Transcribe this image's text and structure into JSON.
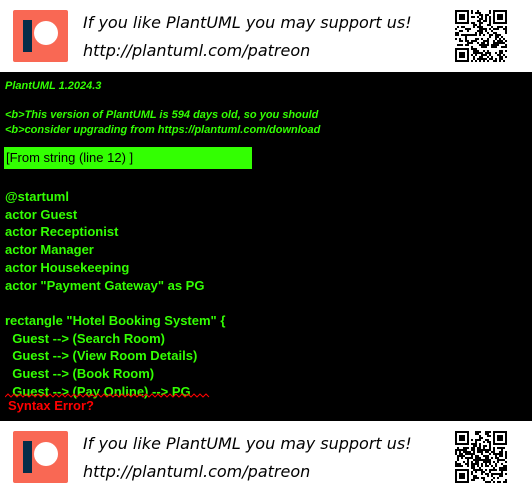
{
  "banner": {
    "line1": "If you like PlantUML you may support us!",
    "line2": "http://plantuml.com/patreon",
    "logo_icon": "patreon-logo-icon",
    "qr_icon": "qr-code-icon",
    "logo_color": "#f96854",
    "logo_dark": "#052d49"
  },
  "console": {
    "version": "PlantUML 1.2024.3",
    "notice_line1": "<b>This version of PlantUML is 594 days old, so you should",
    "notice_line2": "<b>consider upgrading from https://plantuml.com/download",
    "source_ref": "[From string (line 12) ]",
    "code_lines": [
      "@startuml",
      "actor Guest",
      "actor Receptionist",
      "actor Manager",
      "actor Housekeeping",
      "actor \"Payment Gateway\" as PG",
      "",
      "rectangle \"Hotel Booking System\" {",
      "  Guest --> (Search Room)",
      "  Guest --> (View Room Details)",
      "  Guest --> (Book Room)",
      "  Guest --> (Pay Online) --> PG"
    ],
    "error": "Syntax Error?",
    "text_color": "#33ff02",
    "error_color": "#ff0000"
  }
}
